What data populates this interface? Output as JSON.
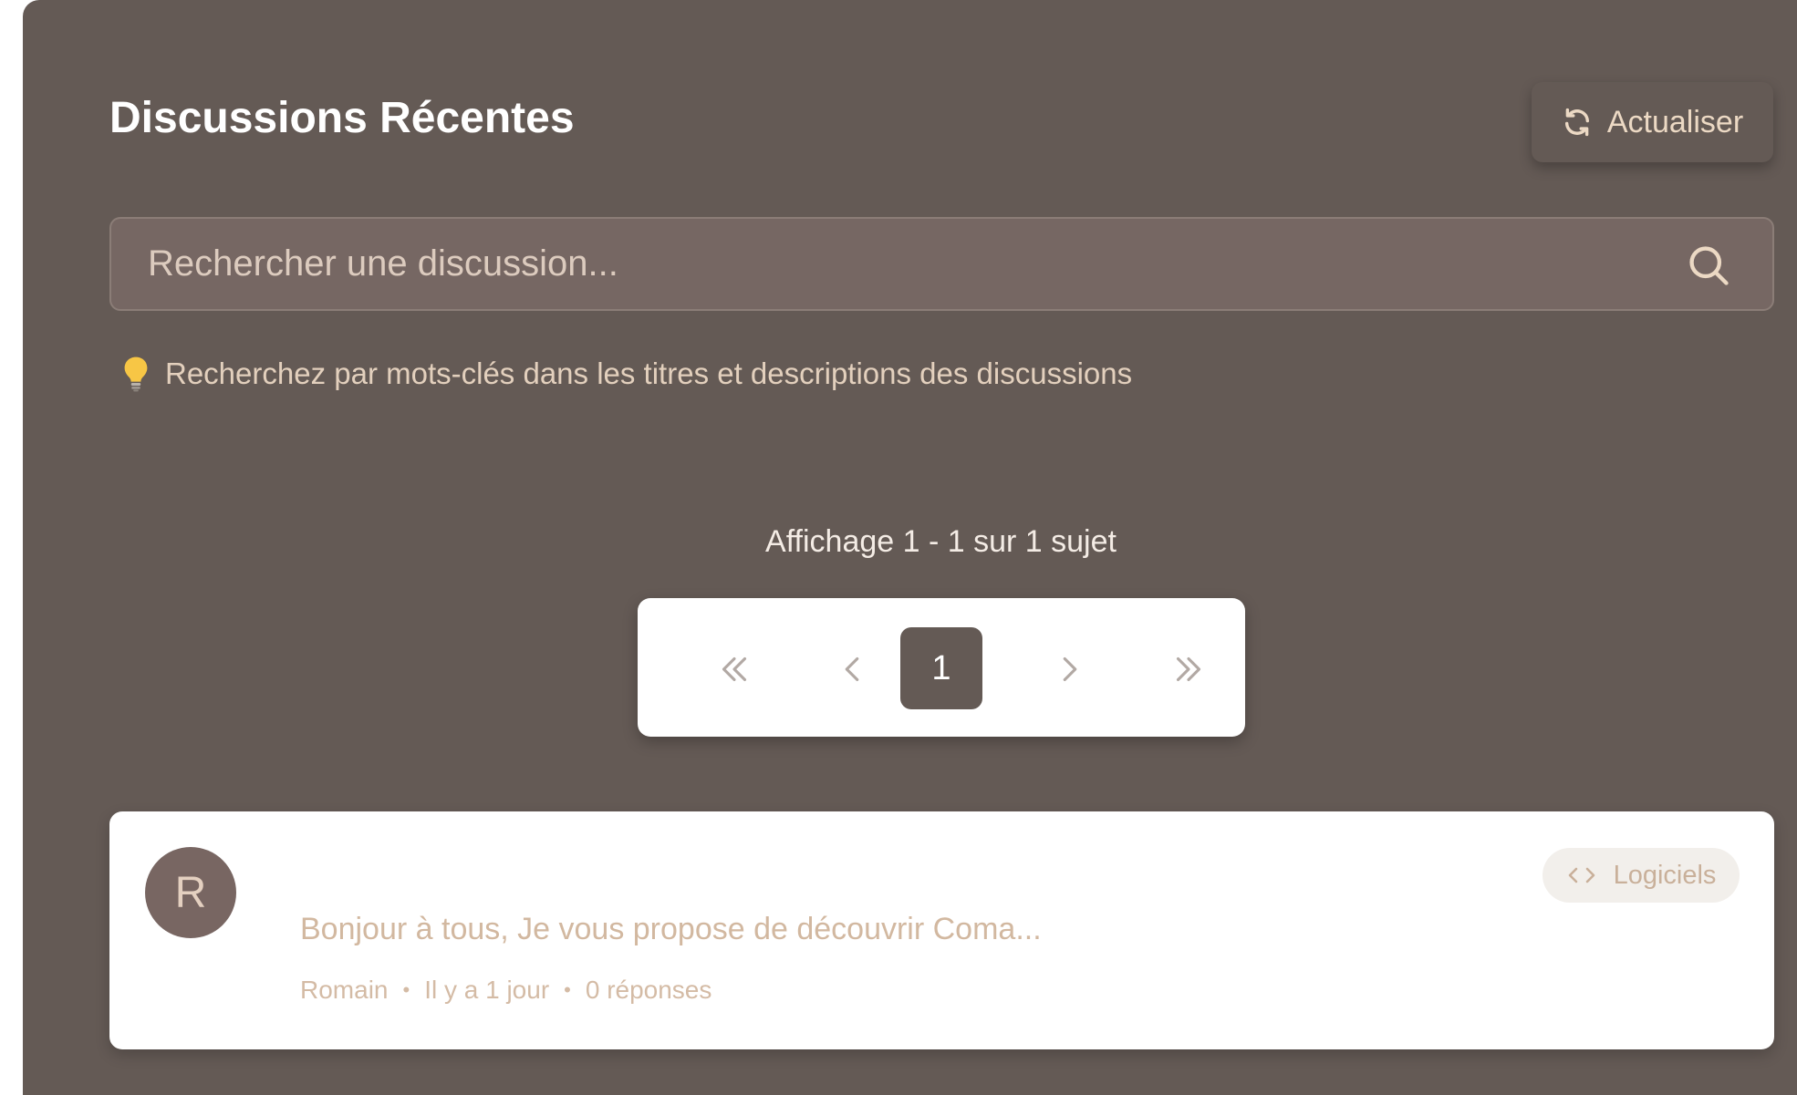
{
  "header": {
    "title": "Discussions Récentes",
    "refresh_label": "Actualiser",
    "refresh_icon": "refresh-icon"
  },
  "search": {
    "placeholder": "Rechercher une discussion...",
    "value": "",
    "icon": "search-icon",
    "hint": "Recherchez par mots-clés dans les titres et descriptions des discussions",
    "hint_icon": "lightbulb-icon"
  },
  "pagination": {
    "info": "Affichage 1 - 1 sur 1 sujet",
    "current_page": "1",
    "first_icon": "chevrons-left-icon",
    "prev_icon": "chevron-left-icon",
    "next_icon": "chevron-right-icon",
    "last_icon": "chevrons-right-icon"
  },
  "topics": [
    {
      "avatar_initial": "R",
      "excerpt": "Bonjour à tous, Je vous propose de découvrir Coma...",
      "author": "Romain",
      "separator": "•",
      "time": "Il y a 1 jour",
      "replies": "0 réponses",
      "category": "Logiciels",
      "category_icon": "code-icon"
    }
  ],
  "colors": {
    "panel_bg": "#645a55",
    "accent_text": "#ecd9c4",
    "search_bg": "#766763",
    "card_bg": "#ffffff",
    "avatar_bg": "#786662",
    "muted_text": "#d2b8a0"
  }
}
